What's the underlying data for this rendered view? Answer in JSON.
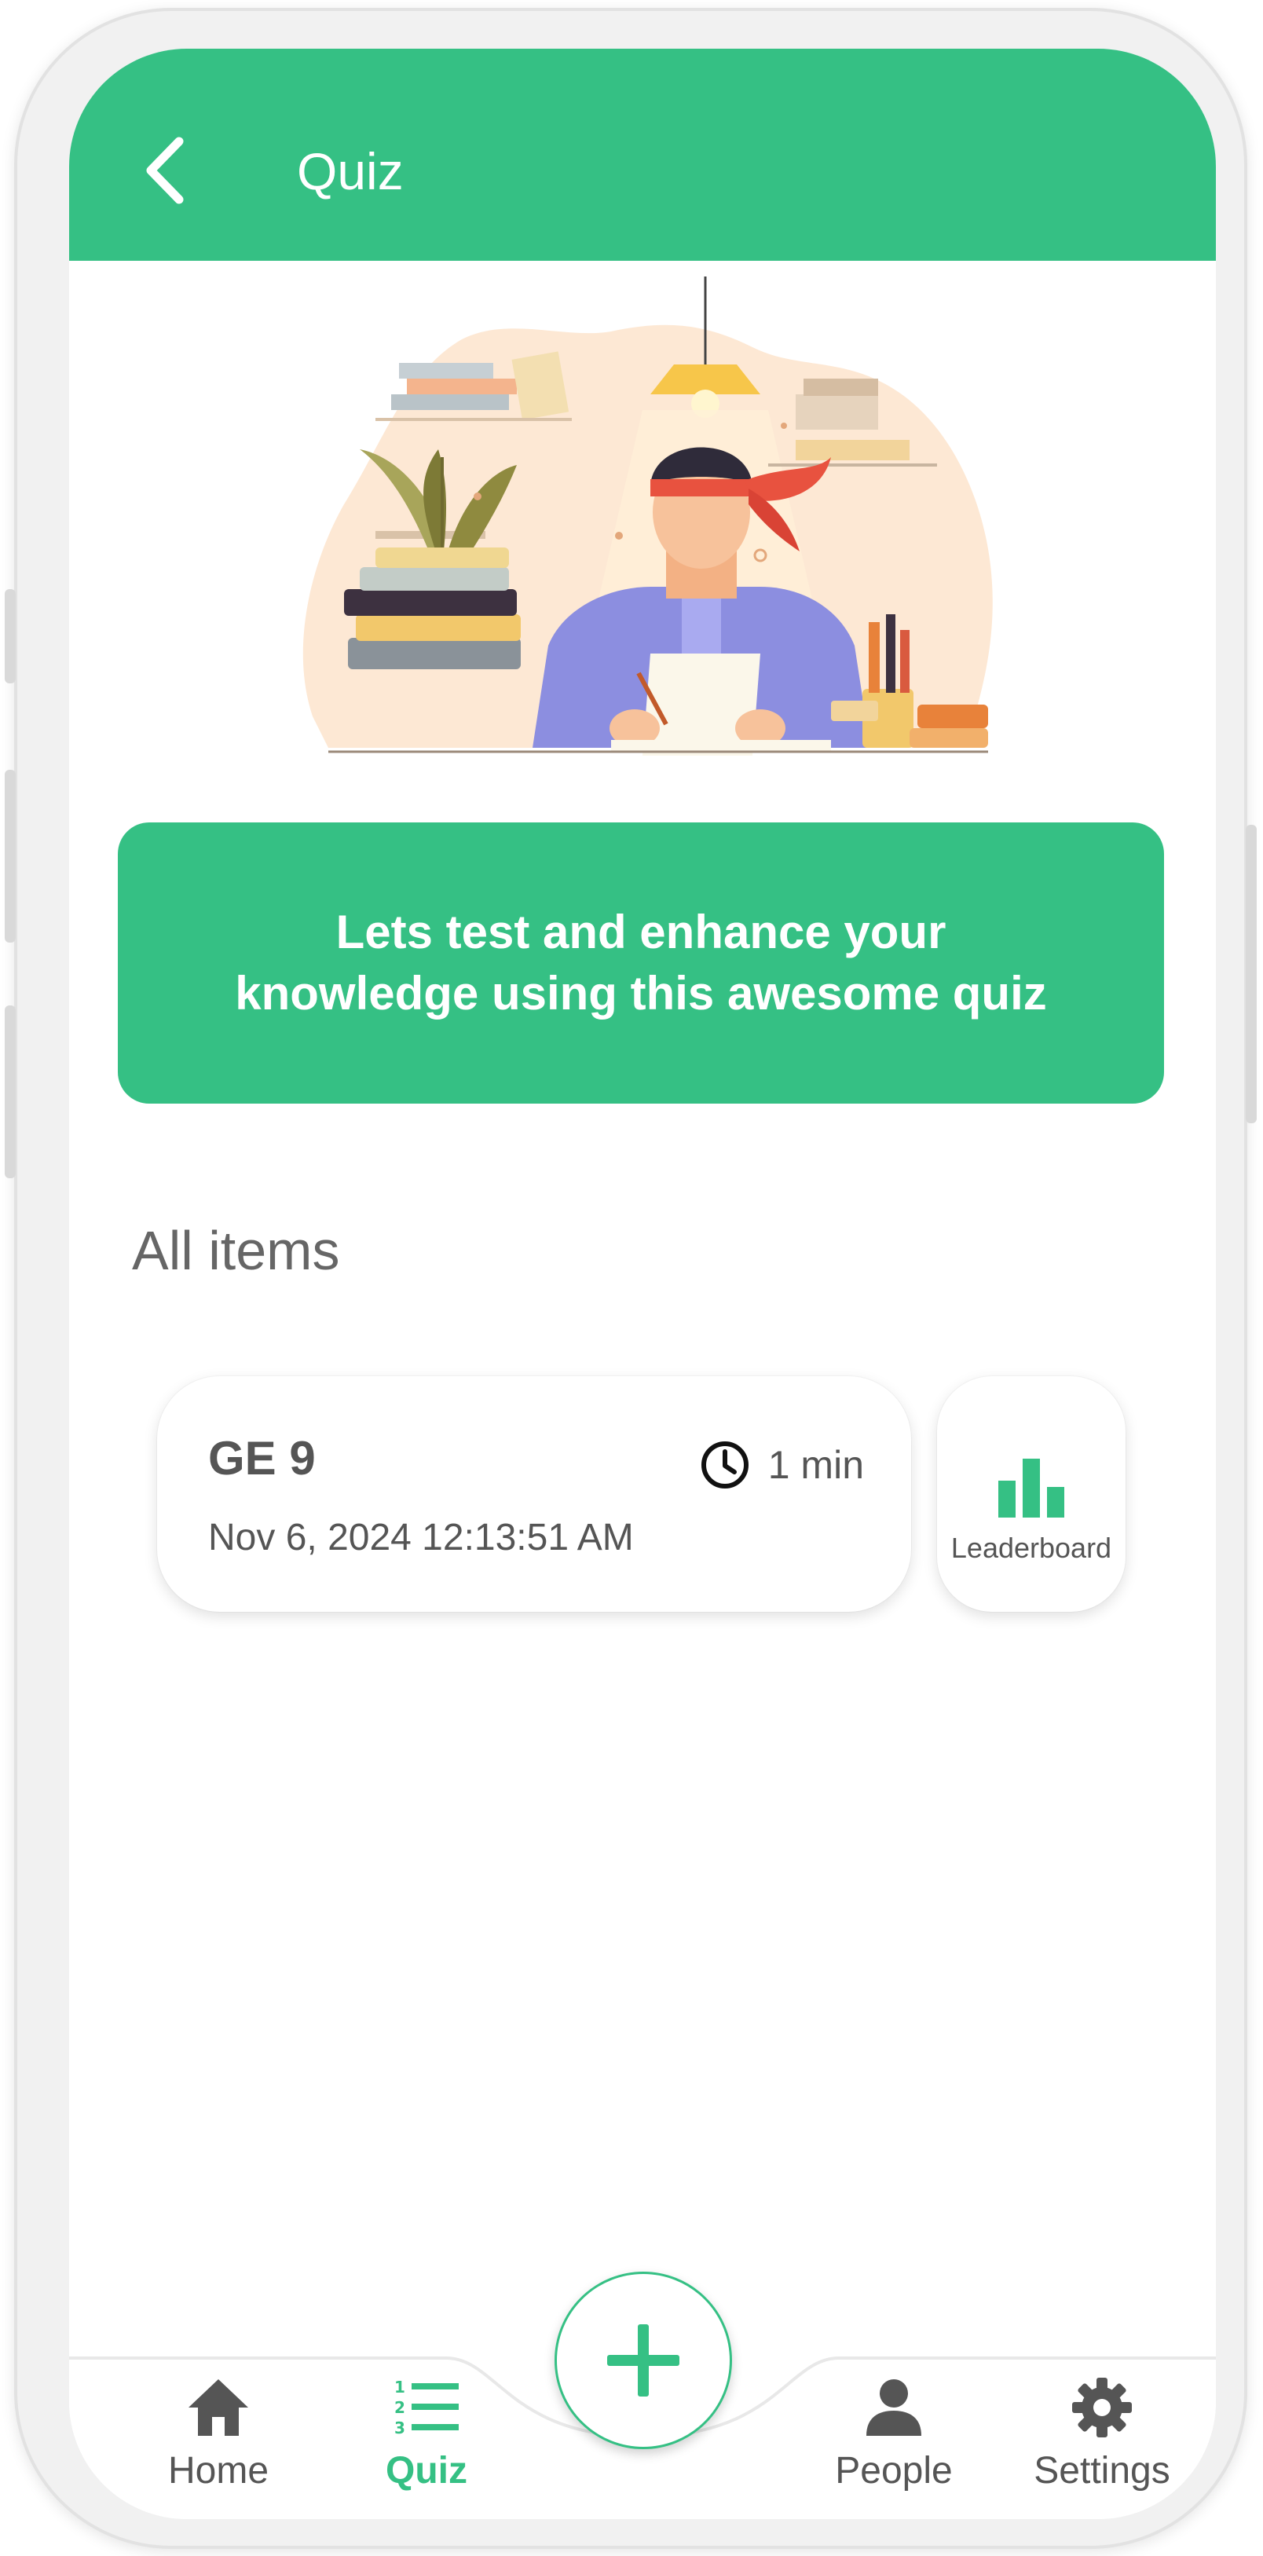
{
  "app": {
    "title": "Quiz"
  },
  "header": {
    "back_icon": "chevron-left-icon",
    "title": "Quiz"
  },
  "banner": {
    "line1": "Lets test and enhance your",
    "line2": "knowledge using this awesome quiz"
  },
  "section": {
    "title": "All items"
  },
  "quiz_items": [
    {
      "name": "GE 9",
      "date": "Nov 6, 2024 12:13:51 AM",
      "duration": "1 min",
      "duration_icon": "clock-icon"
    }
  ],
  "leaderboard": {
    "label": "Leaderboard",
    "icon": "bar-chart-icon"
  },
  "fab": {
    "icon": "plus-icon"
  },
  "nav": {
    "items": [
      {
        "label": "Home",
        "icon": "home-icon",
        "active": false
      },
      {
        "label": "Quiz",
        "icon": "list-numbered-icon",
        "active": true
      },
      {
        "label": "People",
        "icon": "person-icon",
        "active": false
      },
      {
        "label": "Settings",
        "icon": "gear-icon",
        "active": false
      }
    ]
  },
  "colors": {
    "accent": "#35c084",
    "text": "#555555",
    "heading": "#666666",
    "background": "#ffffff"
  }
}
